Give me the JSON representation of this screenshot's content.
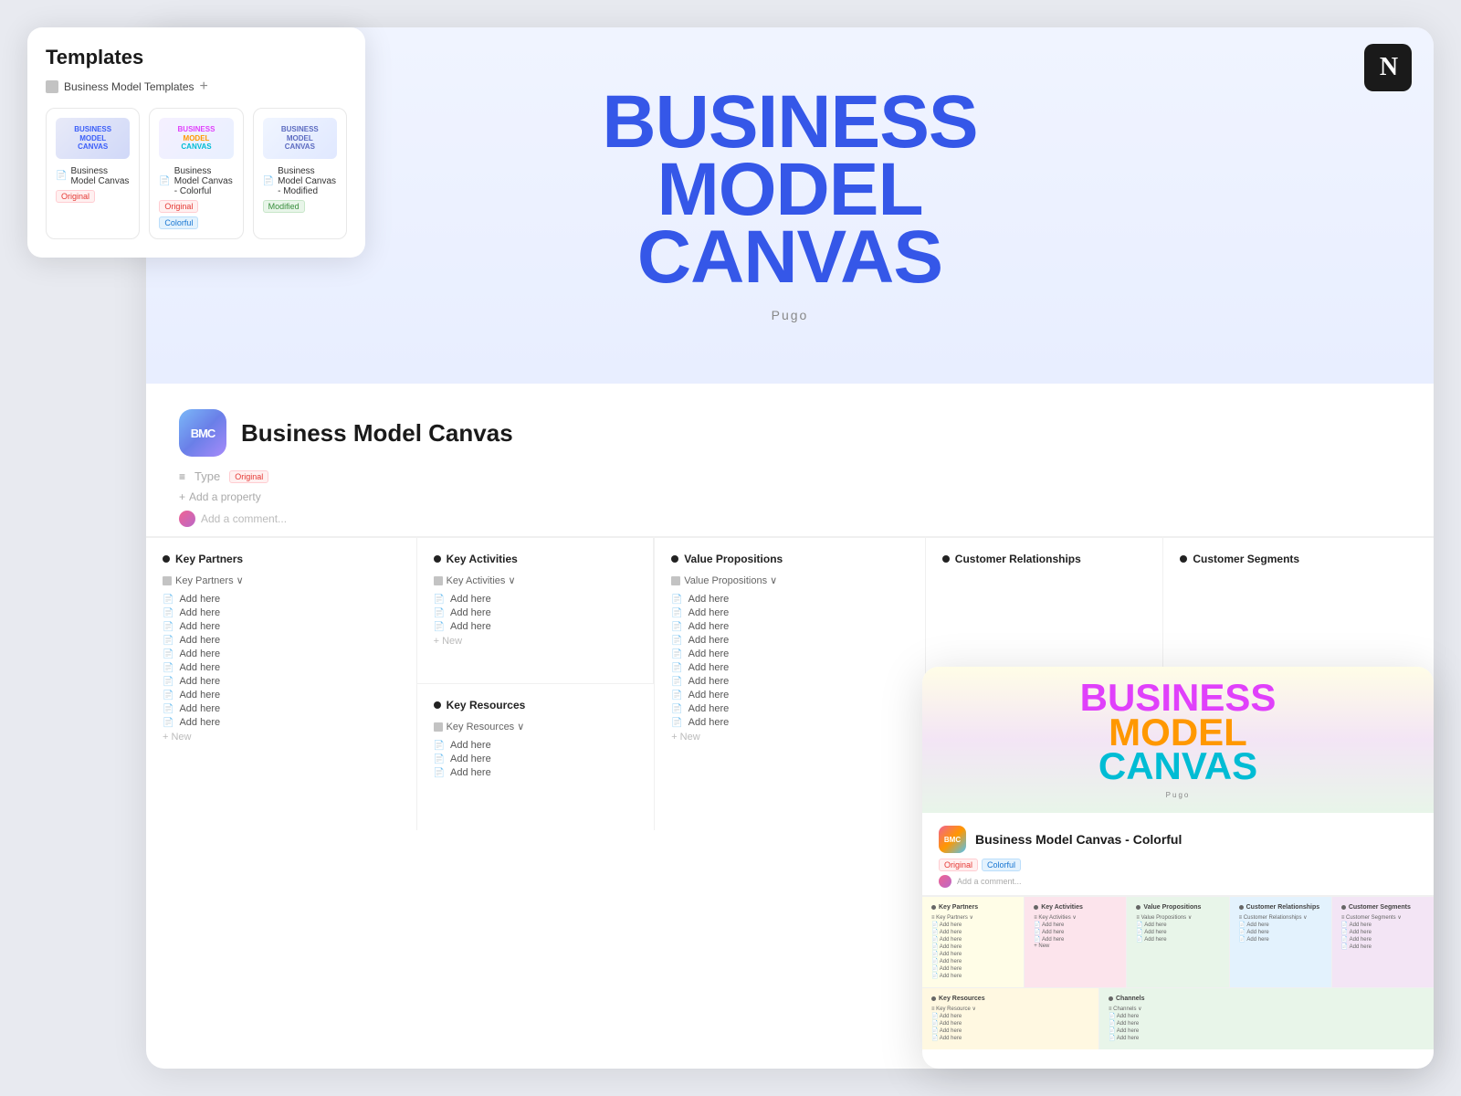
{
  "page": {
    "background": "#e8eaf0"
  },
  "templates_panel": {
    "title": "Templates",
    "tab_icon": "grid-icon",
    "tab_label": "Business Model Templates",
    "add_button": "+",
    "cards": [
      {
        "id": "original",
        "banner_lines": [
          "BUSINESS",
          "MODEL",
          "CANVAS"
        ],
        "banner_style": "original",
        "name": "Business Model Canvas",
        "tags": [
          "Original"
        ]
      },
      {
        "id": "colorful",
        "banner_lines": [
          "BUSINESS",
          "MODEL",
          "CANVAS"
        ],
        "banner_style": "colorful",
        "name": "Business Model Canvas - Colorful",
        "tags": [
          "Original",
          "Colorful"
        ]
      },
      {
        "id": "modified",
        "banner_lines": [
          "BUSINESS",
          "MODEL",
          "CANVAS"
        ],
        "banner_style": "modified",
        "name": "Business Model Canvas - Modified",
        "tags": [
          "Modified"
        ]
      }
    ]
  },
  "main_card": {
    "hero": {
      "title_lines": [
        "BUSINESS",
        "MODEL",
        "CANVAS"
      ],
      "subtitle": "Pugo",
      "notion_icon": "N"
    },
    "detail": {
      "bmc_label": "BMC",
      "title": "Business Model Canvas",
      "type_label": "Type",
      "type_value": "Original",
      "add_property": "Add a property",
      "add_comment": "Add a comment..."
    },
    "canvas": {
      "row1": [
        {
          "label": "Key Partners",
          "db_label": "Key Partners",
          "items": [
            "Add here",
            "Add here",
            "Add here",
            "Add here",
            "Add here",
            "Add here",
            "Add here",
            "Add here",
            "Add here",
            "Add here"
          ]
        },
        {
          "label": "Key Activities",
          "db_label": "Key Activities",
          "items": [
            "Add here",
            "Add here",
            "Add here"
          ]
        },
        {
          "label": "Value Propositions",
          "db_label": "Value Propositions",
          "items": [
            "Add here",
            "Add here",
            "Add here",
            "Add here",
            "Add here",
            "Add here",
            "Add here",
            "Add here",
            "Add here",
            "Add here"
          ]
        },
        {
          "label": "Customer Relationships",
          "db_label": "Customer Relationships",
          "items": []
        },
        {
          "label": "Customer Segments",
          "db_label": "Customer Segments",
          "items": []
        }
      ],
      "row2": [
        {
          "label": "Key Resources",
          "db_label": "Key Resources",
          "items": [
            "Add here",
            "Add here",
            "Add here"
          ]
        }
      ]
    }
  },
  "colorful_card": {
    "hero": {
      "title_lines": [
        "BUSINESS",
        "MODEL",
        "CANVAS"
      ],
      "subtitle": "Pugo"
    },
    "detail": {
      "bmc_label": "BMC",
      "title": "Business Model Canvas - Colorful",
      "tags": [
        "Original",
        "Colorful"
      ],
      "add_comment": "Add a comment..."
    },
    "canvas": {
      "row1_cells": [
        "Key Partners",
        "Key Activities",
        "Value Propositions",
        "Customer Relationships",
        "Customer Segments"
      ],
      "row2_cells": [
        "Key Resources",
        "Channels"
      ]
    }
  }
}
